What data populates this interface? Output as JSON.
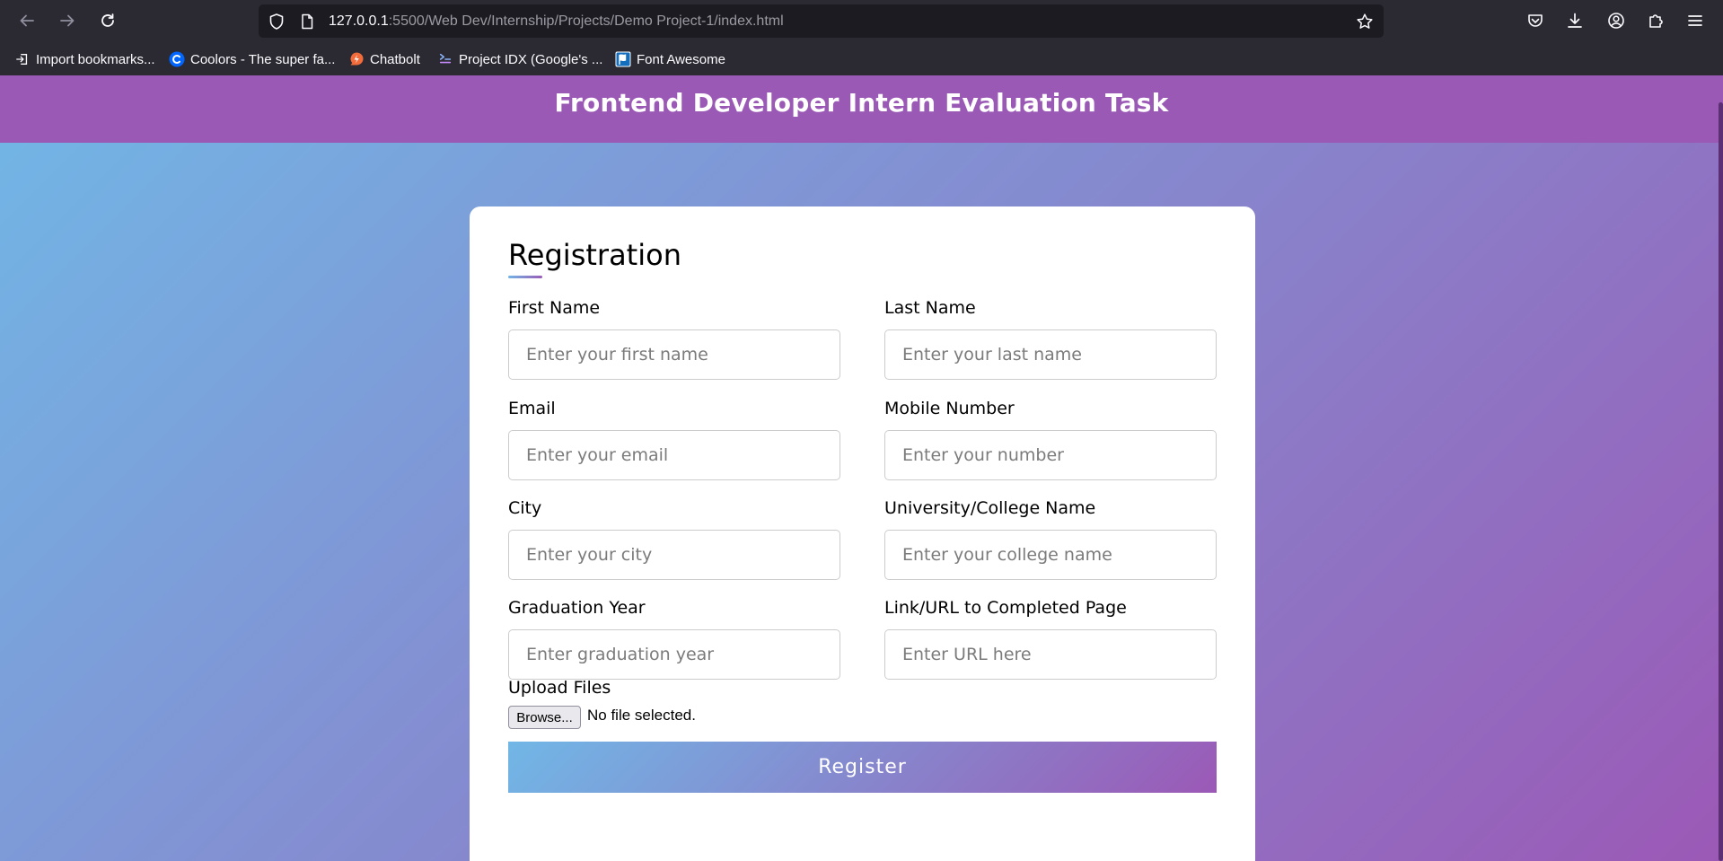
{
  "browser": {
    "url_host": "127.0.0.1",
    "url_rest": ":5500/Web Dev/Internship/Projects/Demo Project-1/index.html",
    "bookmarks": [
      {
        "label": "Import bookmarks...",
        "icon": "import-icon"
      },
      {
        "label": "Coolors - The super fa...",
        "icon": "coolors-icon"
      },
      {
        "label": "Chatbolt",
        "icon": "chatbolt-icon"
      },
      {
        "label": "Project IDX (Google's ...",
        "icon": "idx-icon"
      },
      {
        "label": "Font Awesome",
        "icon": "font-awesome-icon"
      }
    ]
  },
  "page": {
    "header_title": "Frontend Developer Intern Evaluation Task",
    "colors": {
      "gradient_start": "#71b7e6",
      "gradient_end": "#9b59b6",
      "header": "#9b59b6"
    }
  },
  "form": {
    "title": "Registration",
    "fields": [
      {
        "label": "First Name",
        "placeholder": "Enter your first name",
        "value": ""
      },
      {
        "label": "Last Name",
        "placeholder": "Enter your last name",
        "value": ""
      },
      {
        "label": "Email",
        "placeholder": "Enter your email",
        "value": ""
      },
      {
        "label": "Mobile Number",
        "placeholder": "Enter your number",
        "value": ""
      },
      {
        "label": "City",
        "placeholder": "Enter your city",
        "value": ""
      },
      {
        "label": "University/College Name",
        "placeholder": "Enter your college name",
        "value": ""
      },
      {
        "label": "Graduation Year",
        "placeholder": "Enter graduation year",
        "value": ""
      },
      {
        "label": "Link/URL to Completed Page",
        "placeholder": "Enter URL here",
        "value": ""
      }
    ],
    "upload": {
      "label": "Upload Files",
      "browse_label": "Browse...",
      "status": "No file selected."
    },
    "submit_label": "Register"
  }
}
